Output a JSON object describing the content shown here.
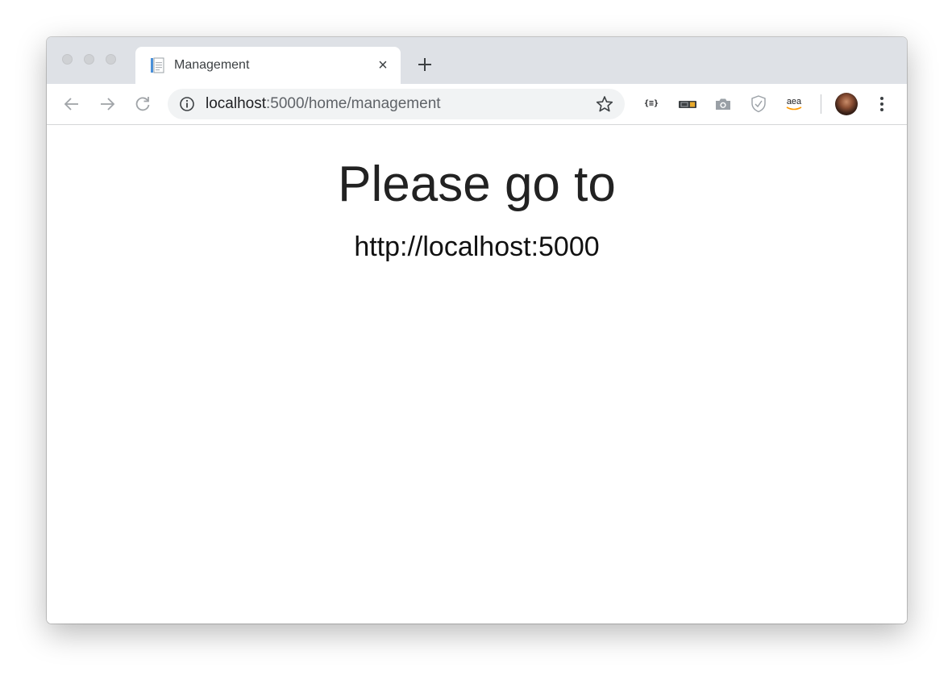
{
  "browser": {
    "tab": {
      "title": "Management",
      "close_glyph": "×"
    },
    "address_bar": {
      "host": "localhost",
      "rest": ":5000/home/management"
    },
    "extensions": {
      "json_formatter_label": "{≡}",
      "amazon_label": "aea"
    },
    "icons": [
      "back-arrow-icon",
      "forward-arrow-icon",
      "reload-icon",
      "info-icon",
      "star-icon",
      "camera-icon",
      "shield-icon",
      "more-vert-icon"
    ],
    "colors": {
      "tabstrip": "#dee1e6",
      "omnibox": "#f1f3f4",
      "amazon_smile": "#ff9900"
    }
  },
  "page": {
    "heading": "Please go to",
    "link": "http://localhost:5000"
  }
}
